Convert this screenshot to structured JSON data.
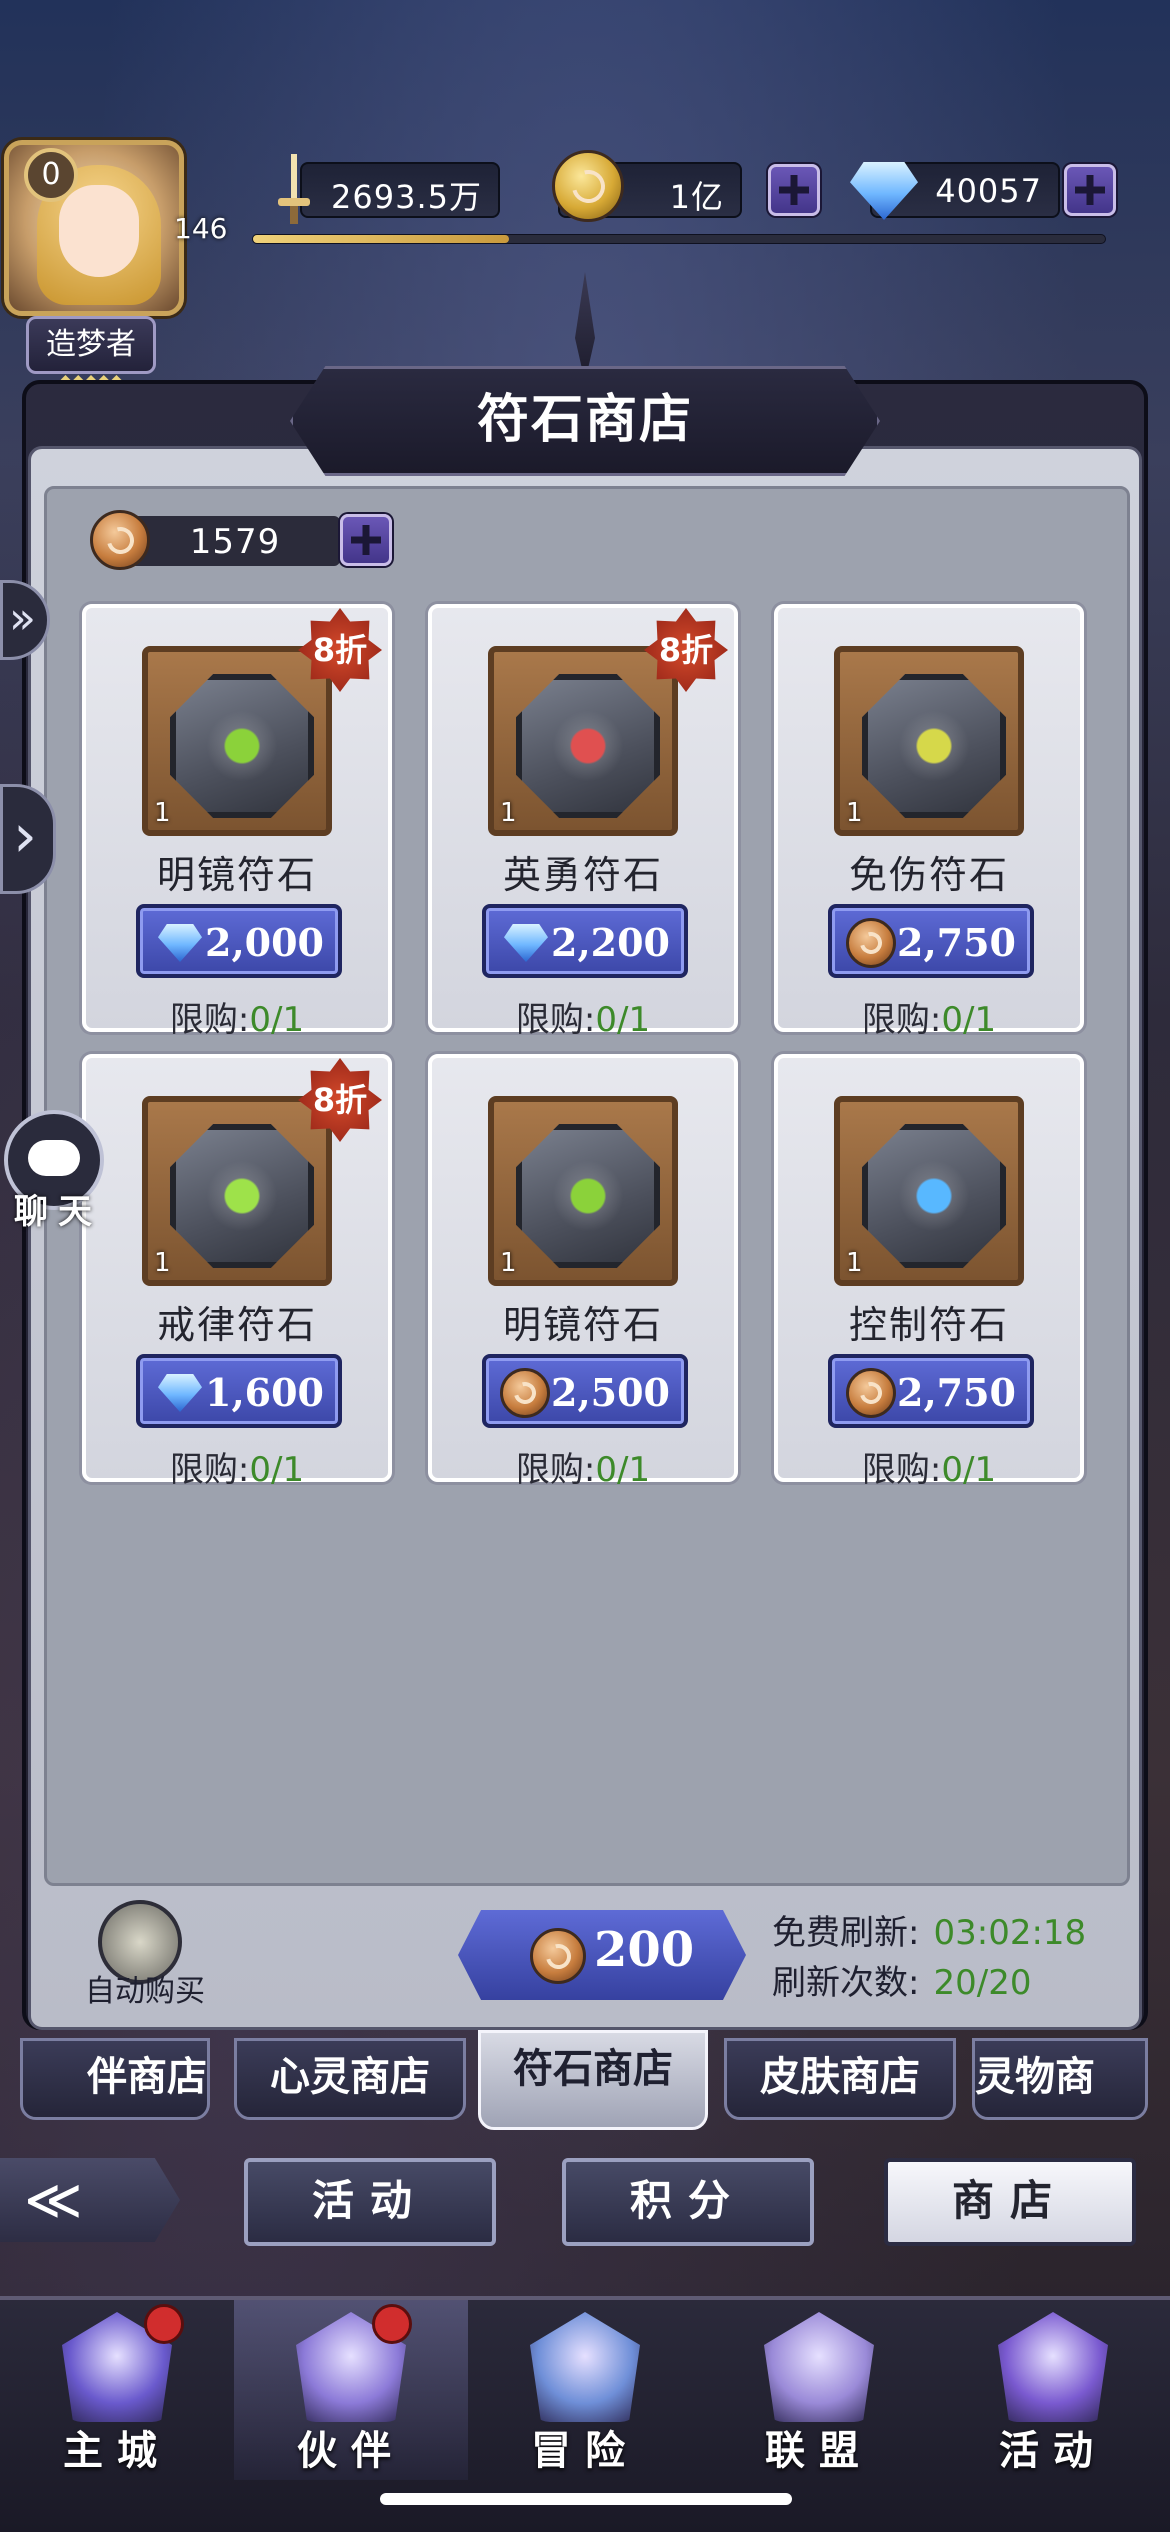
{
  "player": {
    "vip_level": "0",
    "level": "146",
    "title": "造梦者",
    "title_stars": "◆◆◆◆◆",
    "exp_progress": 0.3
  },
  "resources": {
    "power": "2693.5万",
    "gold": "1亿",
    "gems": "40057"
  },
  "shop": {
    "title": "符石商店",
    "rune_currency": "1579",
    "items": [
      {
        "name": "明镜符石",
        "qty": "1",
        "discount": "8折",
        "currency": "gem",
        "price": "2,000",
        "limit_label": "限购:",
        "limit": "0/1",
        "glyph": "leaf-swirl-icon",
        "glyph_color": "#8bd23a"
      },
      {
        "name": "英勇符石",
        "qty": "1",
        "discount": "8折",
        "currency": "gem",
        "price": "2,200",
        "limit_label": "限购:",
        "limit": "0/1",
        "glyph": "fist-icon",
        "glyph_color": "#e05050"
      },
      {
        "name": "免伤符石",
        "qty": "1",
        "discount": "",
        "currency": "rune-coin",
        "price": "2,750",
        "limit_label": "限购:",
        "limit": "0/1",
        "glyph": "figure-icon",
        "glyph_color": "#d6d84a"
      },
      {
        "name": "戒律符石",
        "qty": "1",
        "discount": "8折",
        "currency": "gem",
        "price": "1,600",
        "limit_label": "限购:",
        "limit": "0/1",
        "glyph": "heart-icon",
        "glyph_color": "#9ee24a"
      },
      {
        "name": "明镜符石",
        "qty": "1",
        "discount": "",
        "currency": "rune-coin",
        "price": "2,500",
        "limit_label": "限购:",
        "limit": "0/1",
        "glyph": "leaf-swirl-icon",
        "glyph_color": "#8bd23a"
      },
      {
        "name": "控制符石",
        "qty": "1",
        "discount": "",
        "currency": "rune-coin",
        "price": "2,750",
        "limit_label": "限购:",
        "limit": "0/1",
        "glyph": "target-icon",
        "glyph_color": "#58b8ff"
      }
    ],
    "auto_buy_label": "自动购买",
    "refresh_cost": "200",
    "free_refresh_label": "免费刷新:",
    "free_refresh_time": "03:02:18",
    "refresh_count_label": "刷新次数:",
    "refresh_count": "20/20"
  },
  "tabs": [
    "伴商店",
    "心灵商店",
    "符石商店",
    "皮肤商店",
    "灵物商"
  ],
  "active_tab": 2,
  "subnav": {
    "back_glyph": "≪",
    "items": [
      "活动",
      "积分",
      "商店"
    ],
    "active": 2
  },
  "side": {
    "chat_label": "聊天",
    "expand_glyph": "»",
    "arrow_glyph": "›"
  },
  "bottom_nav": [
    {
      "label": "主城",
      "icon": "castle-icon",
      "badge": true,
      "color": "#6a5acd"
    },
    {
      "label": "伙伴",
      "icon": "witch-hat-icon",
      "badge": true,
      "color": "#8c7ad8"
    },
    {
      "label": "冒险",
      "icon": "compass-icon",
      "badge": false,
      "color": "#6f8fd8"
    },
    {
      "label": "联盟",
      "icon": "shield-icon",
      "badge": false,
      "color": "#9a8ad8"
    },
    {
      "label": "活动",
      "icon": "cards-icon",
      "badge": false,
      "color": "#7a5ad0"
    }
  ],
  "colors": {
    "accent_blue": "#4a56c0",
    "limit_green": "#3d8a2a",
    "discount_red": "#c0392b"
  }
}
